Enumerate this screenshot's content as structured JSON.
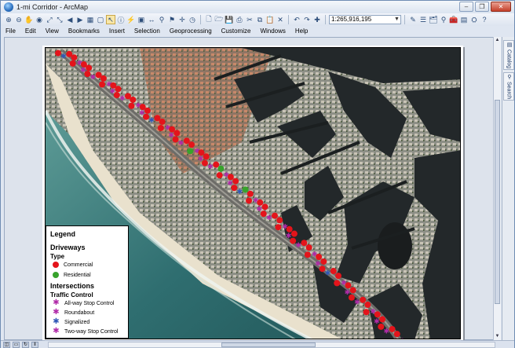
{
  "window": {
    "title": "1-mi Corridor - ArcMap",
    "min": "–",
    "max": "❐",
    "close": "✕"
  },
  "menu": [
    "File",
    "Edit",
    "View",
    "Bookmarks",
    "Insert",
    "Selection",
    "Geoprocessing",
    "Customize",
    "Windows",
    "Help"
  ],
  "toolbar": {
    "scale_value": "1:265,916,195"
  },
  "dock": {
    "catalog": "Catalog",
    "search": "Search"
  },
  "legend": {
    "title": "Legend",
    "driveways_heading": "Driveways",
    "type_heading": "Type",
    "driveway_items": [
      {
        "label": "Commercial",
        "color": "#e4141b"
      },
      {
        "label": "Residential",
        "color": "#38a32c"
      }
    ],
    "intersections_heading": "Intersections",
    "traffic_heading": "Traffic Control",
    "intersection_items": [
      {
        "label": "All-way Stop Control",
        "color": "#b02aa8"
      },
      {
        "label": "Roundabout",
        "color": "#b02aa8"
      },
      {
        "label": "Signalized",
        "color": "#2f57b6"
      },
      {
        "label": "Two-way Stop Control",
        "color": "#b02aa8"
      }
    ]
  }
}
